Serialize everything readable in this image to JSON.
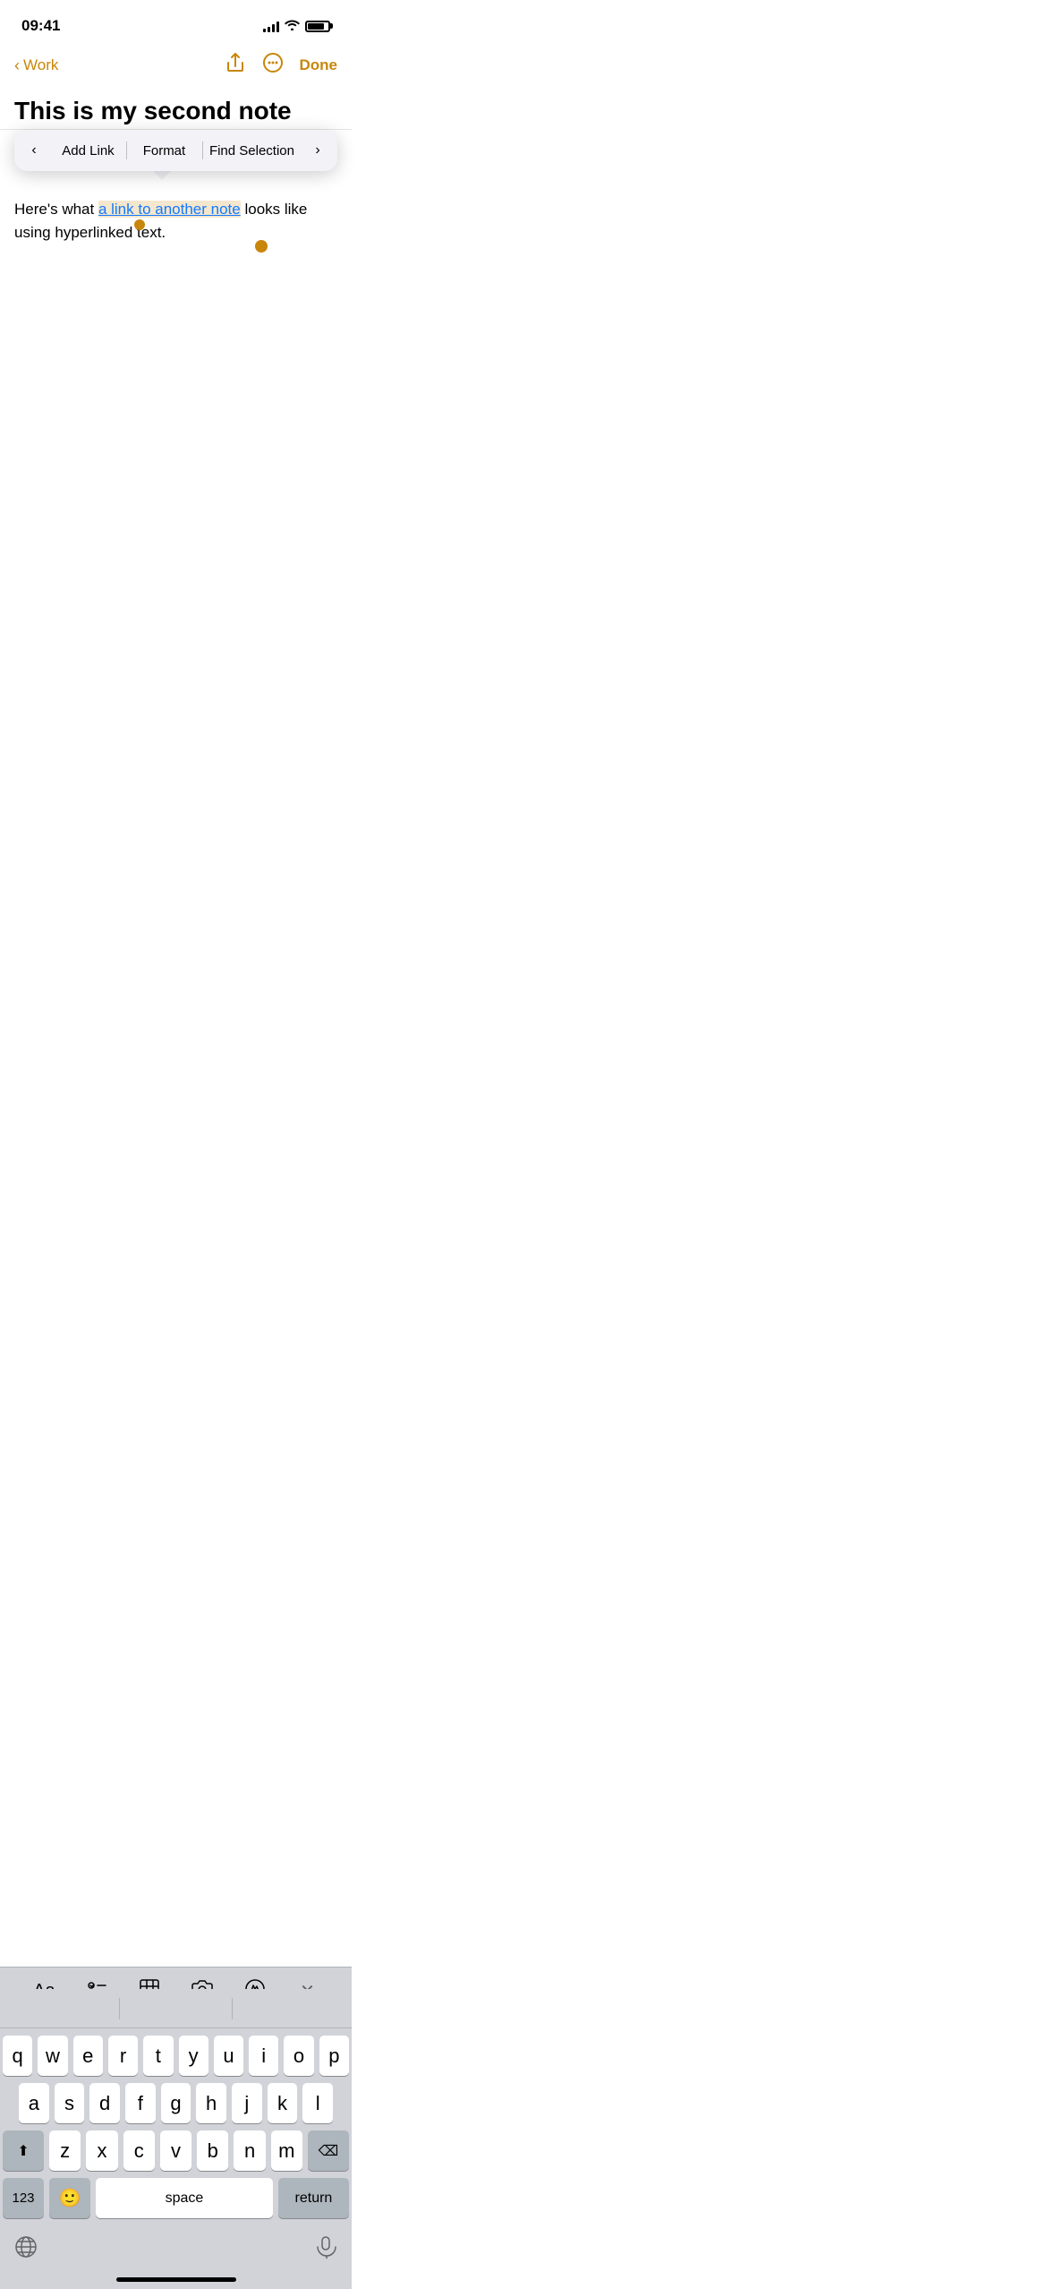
{
  "statusBar": {
    "time": "09:41",
    "signalBars": [
      4,
      6,
      8,
      10,
      13
    ],
    "batteryLevel": 80
  },
  "navBar": {
    "backLabel": "Work",
    "shareIconLabel": "share",
    "moreIconLabel": "more",
    "doneLabel": "Done"
  },
  "note": {
    "title": "This is my second note",
    "body": {
      "beforeSelection": "Here's what ",
      "selectedText": "a link to another note",
      "afterSelection": " looks like using hyperlinked text."
    }
  },
  "contextMenu": {
    "prevLabel": "‹",
    "nextLabel": "›",
    "items": [
      "Add Link",
      "Format",
      "Find Selection"
    ]
  },
  "formatToolbar": {
    "tools": [
      {
        "name": "text-format",
        "label": "Aa"
      },
      {
        "name": "checklist",
        "label": "checklist"
      },
      {
        "name": "table",
        "label": "table"
      },
      {
        "name": "camera",
        "label": "camera"
      },
      {
        "name": "markup",
        "label": "markup"
      },
      {
        "name": "close",
        "label": "close"
      }
    ]
  },
  "keyboard": {
    "suggestionBar": {
      "left": "",
      "center": "",
      "right": ""
    },
    "rows": [
      [
        "q",
        "w",
        "e",
        "r",
        "t",
        "y",
        "u",
        "i",
        "o",
        "p"
      ],
      [
        "a",
        "s",
        "d",
        "f",
        "g",
        "h",
        "j",
        "k",
        "l"
      ],
      [
        "shift",
        "z",
        "x",
        "c",
        "v",
        "b",
        "n",
        "m",
        "delete"
      ],
      [
        "123",
        "emoji",
        "space",
        "return"
      ]
    ],
    "spaceLabel": "space",
    "returnLabel": "return",
    "numbersLabel": "123",
    "shiftSymbol": "⬆",
    "deleteSymbol": "⌫"
  }
}
